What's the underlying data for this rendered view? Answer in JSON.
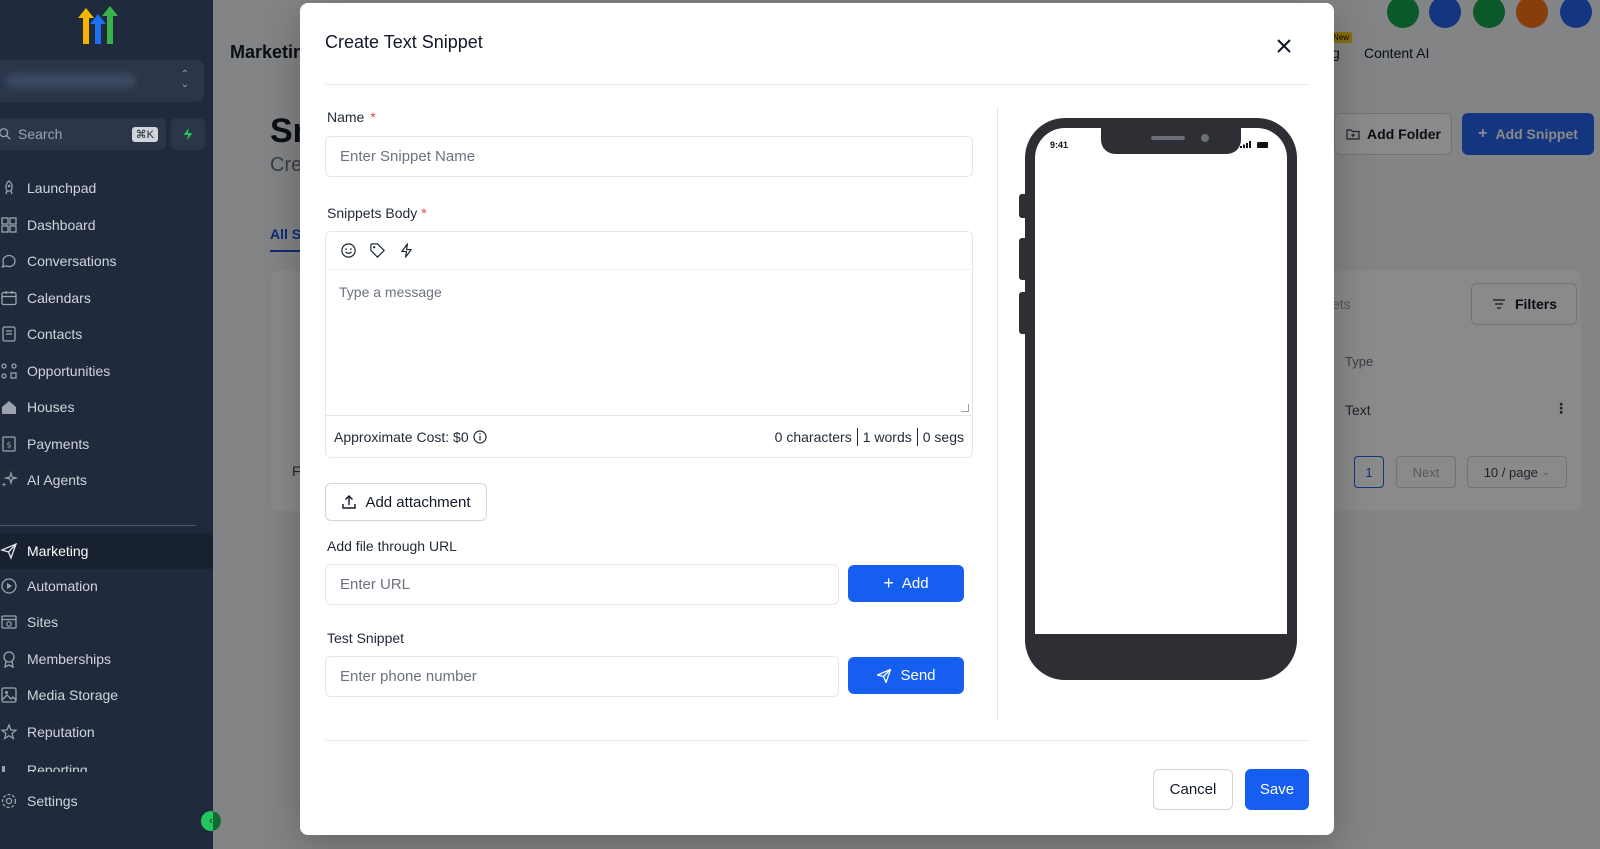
{
  "app": {
    "header_title": "Marketing",
    "content_ai": "Content AI",
    "new_badge": "New",
    "new_item_text": "g"
  },
  "sidebar": {
    "search_placeholder": "Search",
    "search_shortcut": "⌘K",
    "items": [
      {
        "label": "Launchpad",
        "icon": "rocket-icon"
      },
      {
        "label": "Dashboard",
        "icon": "grid-icon"
      },
      {
        "label": "Conversations",
        "icon": "chat-icon"
      },
      {
        "label": "Calendars",
        "icon": "calendar-icon"
      },
      {
        "label": "Contacts",
        "icon": "contacts-icon"
      },
      {
        "label": "Opportunities",
        "icon": "opportunities-icon"
      },
      {
        "label": "Houses",
        "icon": "house-icon"
      },
      {
        "label": "Payments",
        "icon": "payments-icon"
      },
      {
        "label": "AI Agents",
        "icon": "sparkle-icon"
      },
      {
        "label": "Marketing",
        "icon": "send-icon",
        "active": true
      },
      {
        "label": "Automation",
        "icon": "automation-icon"
      },
      {
        "label": "Sites",
        "icon": "sites-icon"
      },
      {
        "label": "Memberships",
        "icon": "award-icon"
      },
      {
        "label": "Media Storage",
        "icon": "image-icon"
      },
      {
        "label": "Reputation",
        "icon": "star-icon"
      },
      {
        "label": "Reporting",
        "icon": "report-icon"
      },
      {
        "label": "Settings",
        "icon": "gear-icon"
      }
    ]
  },
  "background": {
    "page_title": "Sn",
    "page_sub": "Cre",
    "tab_all": "All S",
    "add_folder": "Add Folder",
    "add_snippet": "Add Snippet",
    "search_fragment": "ets",
    "filters": "Filters",
    "col_type": "Type",
    "row_type": "Text",
    "row_first": "F",
    "pager_current": "1",
    "pager_next": "Next",
    "page_size": "10 / page"
  },
  "modal": {
    "title": "Create Text Snippet",
    "name_label": "Name",
    "required_mark": "*",
    "name_placeholder": "Enter Snippet Name",
    "body_label": "Snippets Body",
    "body_placeholder": "Type a message",
    "approx_cost": "Approximate Cost: $0",
    "chars": "0 characters",
    "words": "1 words",
    "segs": "0 segs",
    "add_attachment": "Add attachment",
    "url_label": "Add file through URL",
    "url_placeholder": "Enter URL",
    "add_button": "Add",
    "test_label": "Test Snippet",
    "phone_placeholder": "Enter phone number",
    "send_button": "Send",
    "cancel_button": "Cancel",
    "save_button": "Save",
    "phone_time": "9:41"
  },
  "colors": {
    "sidebar_bg": "#1f2a3c",
    "primary": "#155eef",
    "required": "#ef4444"
  }
}
